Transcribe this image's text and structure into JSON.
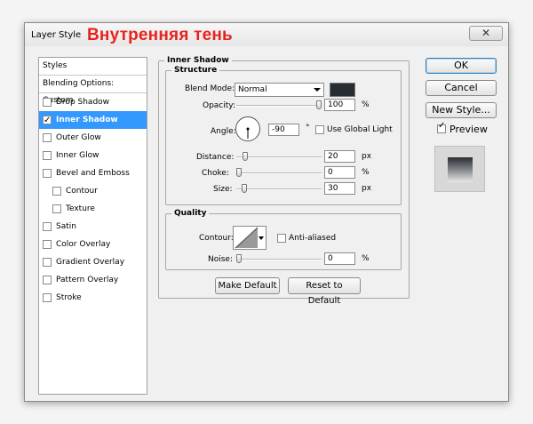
{
  "window": {
    "title": "Layer Style",
    "caption_overlay": "Внутренняя тень",
    "close_glyph": "✕"
  },
  "badge": {
    "hex": "# 282d32",
    "color": "#282d32"
  },
  "sidebar": {
    "header": "Styles",
    "blending": "Blending Options: Custom",
    "items": [
      {
        "label": "Drop Shadow",
        "checked": false,
        "indent": false
      },
      {
        "label": "Inner Shadow",
        "checked": true,
        "indent": false,
        "selected": true
      },
      {
        "label": "Outer Glow",
        "checked": false,
        "indent": false
      },
      {
        "label": "Inner Glow",
        "checked": false,
        "indent": false
      },
      {
        "label": "Bevel and Emboss",
        "checked": false,
        "indent": false
      },
      {
        "label": "Contour",
        "checked": false,
        "indent": true
      },
      {
        "label": "Texture",
        "checked": false,
        "indent": true
      },
      {
        "label": "Satin",
        "checked": false,
        "indent": false
      },
      {
        "label": "Color Overlay",
        "checked": false,
        "indent": false
      },
      {
        "label": "Gradient Overlay",
        "checked": false,
        "indent": false
      },
      {
        "label": "Pattern Overlay",
        "checked": false,
        "indent": false
      },
      {
        "label": "Stroke",
        "checked": false,
        "indent": false
      }
    ]
  },
  "inner_shadow": {
    "legend": "Inner Shadow",
    "structure": {
      "legend": "Structure",
      "blend_mode_label": "Blend Mode:",
      "blend_mode_value": "Normal",
      "shadow_color": "#282d32",
      "opacity_label": "Opacity:",
      "opacity_value": "100",
      "opacity_unit": "%",
      "opacity_fraction": 1.0,
      "angle_label": "Angle:",
      "angle_value": "-90",
      "angle_unit": "°",
      "global_light_label": "Use Global Light",
      "global_light_checked": false,
      "distance_label": "Distance:",
      "distance_value": "20",
      "distance_unit": "px",
      "distance_fraction": 0.08,
      "choke_label": "Choke:",
      "choke_value": "0",
      "choke_unit": "%",
      "choke_fraction": 0.0,
      "size_label": "Size:",
      "size_value": "30",
      "size_unit": "px",
      "size_fraction": 0.07
    },
    "quality": {
      "legend": "Quality",
      "contour_label": "Contour:",
      "anti_aliased_label": "Anti-aliased",
      "anti_aliased_checked": false,
      "noise_label": "Noise:",
      "noise_value": "0",
      "noise_unit": "%",
      "noise_fraction": 0.0
    },
    "make_default": "Make Default",
    "reset_default": "Reset to Default"
  },
  "actions": {
    "ok": "OK",
    "cancel": "Cancel",
    "new_style": "New Style...",
    "preview_label": "Preview",
    "preview_checked": true
  }
}
